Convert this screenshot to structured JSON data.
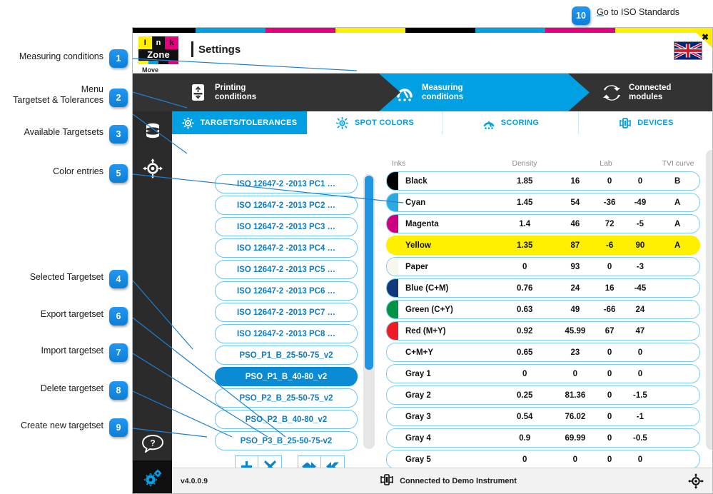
{
  "top_note": {
    "badge": "10",
    "label": "Go to ISO Standards"
  },
  "annotations": [
    {
      "num": "1",
      "label": "Measuring conditions"
    },
    {
      "num": "2",
      "label": "Menu\nTargetset & Tolerances"
    },
    {
      "num": "3",
      "label": "Available Targetsets"
    },
    {
      "num": "5",
      "label": "Color entries"
    },
    {
      "num": "4",
      "label": "Selected Targetset"
    },
    {
      "num": "6",
      "label": "Export targetset"
    },
    {
      "num": "7",
      "label": "Import targetset"
    },
    {
      "num": "8",
      "label": "Delete targetset"
    },
    {
      "num": "9",
      "label": "Create new targetset"
    }
  ],
  "window": {
    "logo_letters": [
      "I",
      "n",
      "k"
    ],
    "logo_word": "Zone",
    "logo_sub": "Move",
    "title": "Settings",
    "close_label": "✖",
    "flag": "uk-flag",
    "cmyk_colors": [
      "#000000",
      "#00a0e3",
      "#e3007f",
      "#fff000"
    ]
  },
  "nav": [
    {
      "label": "Printing\nconditions",
      "icon": "printing-press-icon",
      "active": false
    },
    {
      "label": "Measuring\nconditions",
      "icon": "measuring-icon",
      "active": true
    },
    {
      "label": "Connected\nmodules",
      "icon": "sync-arrows-icon",
      "active": false
    }
  ],
  "tabs": [
    {
      "label": "TARGETS/TOLERANCES",
      "icon": "target-tolerance-icon",
      "active": true
    },
    {
      "label": "SPOT COLORS",
      "icon": "spot-color-icon",
      "active": false
    },
    {
      "label": "SCORING",
      "icon": "scoring-icon",
      "active": false
    },
    {
      "label": "DEVICES",
      "icon": "device-icon",
      "active": false
    }
  ],
  "rail": [
    {
      "name": "folder-icon"
    },
    {
      "name": "database-icon"
    },
    {
      "name": "target-icon"
    },
    {
      "name": "help-icon"
    },
    {
      "name": "settings-gears-icon"
    }
  ],
  "targetsets": {
    "items": [
      {
        "label": "ISO 12647-2 -2013 PC1 …",
        "selected": false
      },
      {
        "label": "ISO 12647-2 -2013 PC2 …",
        "selected": false
      },
      {
        "label": "ISO 12647-2 -2013 PC3 …",
        "selected": false
      },
      {
        "label": "ISO 12647-2 -2013 PC4 …",
        "selected": false
      },
      {
        "label": "ISO 12647-2 -2013 PC5 …",
        "selected": false
      },
      {
        "label": "ISO 12647-2 -2013 PC6 …",
        "selected": false
      },
      {
        "label": "ISO 12647-2 -2013 PC7 …",
        "selected": false
      },
      {
        "label": "ISO 12647-2 -2013 PC8 …",
        "selected": false
      },
      {
        "label": "PSO_P1_B_25-50-75_v2",
        "selected": false
      },
      {
        "label": "PSO_P1_B_40-80_v2",
        "selected": true
      },
      {
        "label": "PSO_P2_B_25-50-75_v2",
        "selected": false
      },
      {
        "label": "PSO_P2_B_40-80_v2",
        "selected": false
      },
      {
        "label": "PSO_P3_B_25-50-75-v2",
        "selected": false
      }
    ],
    "tools": [
      {
        "name": "create-new-targetset-button",
        "glyph": "✚"
      },
      {
        "name": "delete-targetset-button",
        "glyph": "✖"
      },
      {
        "name": "export-targetset-button",
        "glyph": "export"
      },
      {
        "name": "import-targetset-button",
        "glyph": "import"
      }
    ]
  },
  "table": {
    "headers": {
      "inks": "Inks",
      "density": "Density",
      "lab": "Lab",
      "tvi": "TVI curve"
    },
    "rows": [
      {
        "name": "Black",
        "swatch": "#000000",
        "density": "1.85",
        "l": "16",
        "a": "0",
        "b": "0",
        "tvi": "B",
        "highlight": false
      },
      {
        "name": "Cyan",
        "swatch": "#29abe2",
        "density": "1.45",
        "l": "54",
        "a": "-36",
        "b": "-49",
        "tvi": "A",
        "highlight": false
      },
      {
        "name": "Magenta",
        "swatch": "#cc0080",
        "density": "1.4",
        "l": "46",
        "a": "72",
        "b": "-5",
        "tvi": "A",
        "highlight": false
      },
      {
        "name": "Yellow",
        "swatch": "#fff000",
        "density": "1.35",
        "l": "87",
        "a": "-6",
        "b": "90",
        "tvi": "A",
        "highlight": true
      },
      {
        "name": "Paper",
        "swatch": "#f7f7ee",
        "density": "0",
        "l": "93",
        "a": "0",
        "b": "-3",
        "tvi": "",
        "highlight": false
      },
      {
        "name": "Blue (C+M)",
        "swatch": "#11377c",
        "density": "0.76",
        "l": "24",
        "a": "16",
        "b": "-45",
        "tvi": "",
        "highlight": false
      },
      {
        "name": "Green (C+Y)",
        "swatch": "#009245",
        "density": "0.63",
        "l": "49",
        "a": "-66",
        "b": "24",
        "tvi": "",
        "highlight": false
      },
      {
        "name": "Red (M+Y)",
        "swatch": "#ed1c24",
        "density": "0.92",
        "l": "45.99",
        "a": "67",
        "b": "47",
        "tvi": "",
        "highlight": false
      },
      {
        "name": "C+M+Y",
        "swatch": "",
        "density": "0.65",
        "l": "23",
        "a": "0",
        "b": "0",
        "tvi": "",
        "highlight": false
      },
      {
        "name": "Gray 1",
        "swatch": "",
        "density": "0",
        "l": "0",
        "a": "0",
        "b": "0",
        "tvi": "",
        "highlight": false
      },
      {
        "name": "Gray 2",
        "swatch": "",
        "density": "0.25",
        "l": "81.36",
        "a": "0",
        "b": "-1.5",
        "tvi": "",
        "highlight": false
      },
      {
        "name": "Gray 3",
        "swatch": "",
        "density": "0.54",
        "l": "76.02",
        "a": "0",
        "b": "-1",
        "tvi": "",
        "highlight": false
      },
      {
        "name": "Gray 4",
        "swatch": "",
        "density": "0.9",
        "l": "69.99",
        "a": "0",
        "b": "-0.5",
        "tvi": "",
        "highlight": false
      },
      {
        "name": "Gray 5",
        "swatch": "",
        "density": "0",
        "l": "0",
        "a": "0",
        "b": "0",
        "tvi": "",
        "highlight": false
      }
    ]
  },
  "status": {
    "version": "v4.0.0.9",
    "connection": "Connected to Demo Instrument",
    "connection_icon": "instrument-icon",
    "right_icon": "target-icon"
  }
}
